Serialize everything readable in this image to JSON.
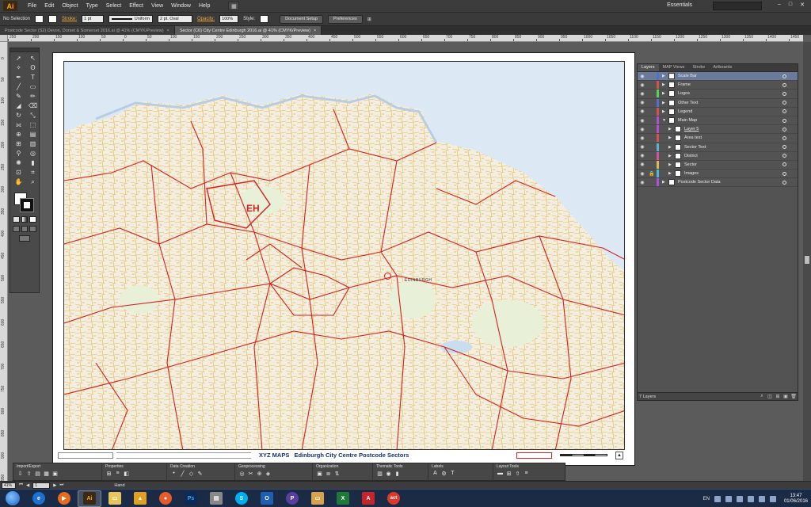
{
  "app": {
    "logo_text": "Ai",
    "menu": [
      "File",
      "Edit",
      "Object",
      "Type",
      "Select",
      "Effect",
      "View",
      "Window",
      "Help"
    ],
    "workspace": "Essentials",
    "window_controls": [
      "–",
      "□",
      "✕"
    ]
  },
  "control_bar": {
    "selection": "No Selection",
    "stroke_label": "Stroke:",
    "stroke_weight": "1 pt",
    "stroke_profile": "Uniform",
    "brush": "2 pt. Oval",
    "opacity_label": "Opacity:",
    "opacity_value": "100%",
    "style_label": "Style:",
    "document_setup": "Document Setup",
    "preferences": "Preferences"
  },
  "tabs": [
    {
      "label": "Postcode Sector (S2) Devon, Dorset & Somerset 2016.ai @ 41% (CMYK/Preview)",
      "active": false
    },
    {
      "label": "Sector (C6) City Centre Edinburgh 2016.ai @ 41% (CMYK/Preview)",
      "active": true
    }
  ],
  "ruler_h": [
    "250",
    "200",
    "150",
    "100",
    "50",
    "0",
    "50",
    "100",
    "150",
    "200",
    "250",
    "300",
    "350",
    "400",
    "450",
    "500",
    "550",
    "600",
    "650",
    "700",
    "750",
    "800",
    "850",
    "900",
    "950",
    "1000",
    "1050",
    "1100",
    "1150",
    "1200",
    "1250",
    "1300",
    "1350",
    "1400",
    "1450"
  ],
  "ruler_v": [
    "0",
    "50",
    "100",
    "150",
    "200",
    "250",
    "300",
    "350",
    "400",
    "450",
    "500",
    "550",
    "600",
    "650",
    "700",
    "750",
    "800",
    "850",
    "900",
    "950",
    "1000"
  ],
  "map": {
    "area_label": "EH",
    "place_label": "EDINBURGH",
    "footer_brand": "XYZ MAPS",
    "footer_title": "Edinburgh City Centre Postcode Sectors"
  },
  "layers_panel": {
    "tabs": [
      "Layers",
      "MAP Views",
      "Stroke",
      "Artboards"
    ],
    "layers": [
      {
        "name": "Scale Bar",
        "color": "#4f6fd6",
        "selected": true
      },
      {
        "name": "Frame",
        "color": "#d94f4f",
        "selected": false
      },
      {
        "name": "Logos",
        "color": "#4fd94f",
        "selected": false
      },
      {
        "name": "Other Text",
        "color": "#4f6fd6",
        "selected": false
      },
      {
        "name": "Legend",
        "color": "#d94f4f",
        "selected": false
      },
      {
        "name": "Main Map",
        "color": "#b14fd9",
        "selected": false
      },
      {
        "name": "Layer 5",
        "color": "#b14fd9",
        "selected": false
      },
      {
        "name": "Area text",
        "color": "#d94f4f",
        "selected": false
      },
      {
        "name": "Sector Text",
        "color": "#4fb8d9",
        "selected": false
      },
      {
        "name": "District",
        "color": "#d94fa8",
        "selected": false
      },
      {
        "name": "Sector",
        "color": "#d9b84f",
        "selected": false
      },
      {
        "name": "Images",
        "color": "#4fb8d9",
        "selected": false
      },
      {
        "name": "Postcode Sector Data",
        "color": "#b14fd9",
        "selected": false
      }
    ],
    "count": "7 Layers"
  },
  "bottom_toolbar": {
    "groups": [
      "Import/Export",
      "Properties",
      "Data Creation",
      "Geoprocessing",
      "Organization",
      "Thematic Tools",
      "Labels",
      "Layout Tools"
    ]
  },
  "status": {
    "zoom": "41%",
    "artboard": "1",
    "tool": "Hand"
  },
  "taskbar": {
    "lang": "EN",
    "time": "13:47",
    "date": "01/06/2016"
  }
}
